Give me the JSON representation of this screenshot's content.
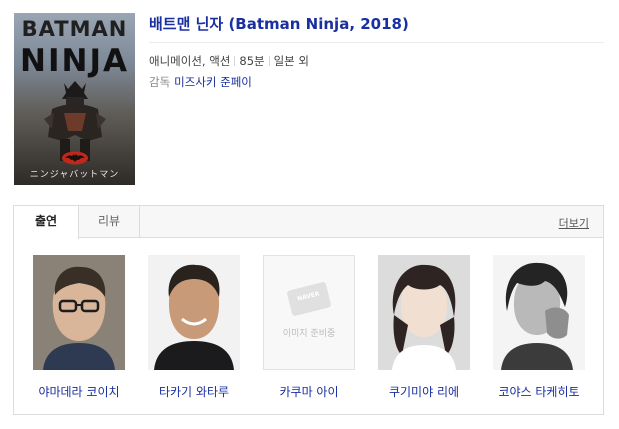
{
  "movie": {
    "poster": {
      "title_line1": "BATMAN",
      "title_line2": "NINJA",
      "subtitle_jp": "ニンジャバットマン"
    },
    "title": "배트맨 닌자 (Batman Ninja, 2018)",
    "genre": "애니메이션, 액션",
    "runtime": "85분",
    "country": "일본 외",
    "director_label": "감독",
    "director_name": "미즈사키 준페이"
  },
  "tabs": [
    {
      "label": "출연",
      "active": true
    },
    {
      "label": "리뷰",
      "active": false
    }
  ],
  "more_label": "더보기",
  "cast": [
    {
      "name": "야마데라 코이치",
      "photo": "portrait"
    },
    {
      "name": "타카기 와타루",
      "photo": "portrait"
    },
    {
      "name": "카쿠마 아이",
      "photo": "placeholder"
    },
    {
      "name": "쿠기미야 리에",
      "photo": "portrait"
    },
    {
      "name": "코야스 타케히토",
      "photo": "portrait"
    }
  ],
  "placeholder": {
    "badge": "NAVER",
    "text": "이미지 준비중"
  },
  "colors": {
    "link": "#1a2fa0",
    "border": "#dcdcdc",
    "tab_bg": "#f7f7f7"
  }
}
